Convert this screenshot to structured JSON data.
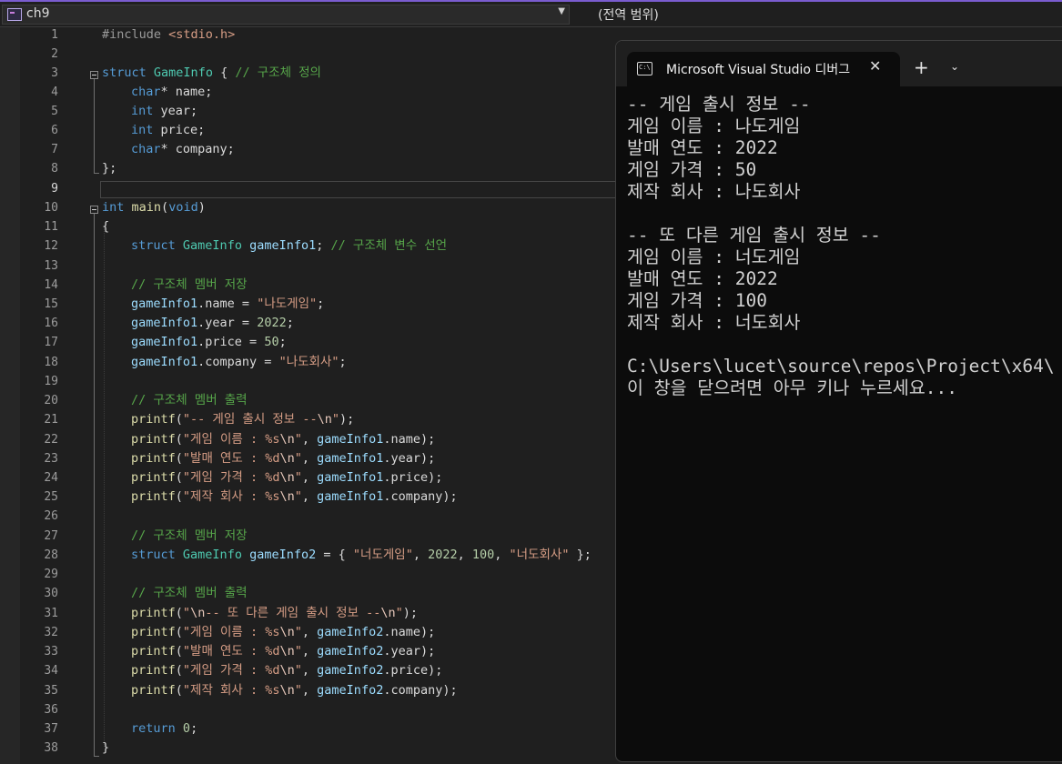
{
  "navbar": {
    "project": "ch9",
    "scope": "(전역 범위)"
  },
  "editor": {
    "line_numbers": [
      "1",
      "2",
      "3",
      "4",
      "5",
      "6",
      "7",
      "8",
      "9",
      "10",
      "11",
      "12",
      "13",
      "14",
      "15",
      "16",
      "17",
      "18",
      "19",
      "20",
      "21",
      "22",
      "23",
      "24",
      "25",
      "26",
      "27",
      "28",
      "29",
      "30",
      "31",
      "32",
      "33",
      "34",
      "35",
      "36",
      "37",
      "38"
    ],
    "tokens": {
      "l1": [
        "#include ",
        "<stdio.h>"
      ],
      "l3": [
        "struct",
        " ",
        "GameInfo",
        " { ",
        "// 구조체 정의"
      ],
      "l4": [
        "char",
        "* name;"
      ],
      "l5": [
        "int",
        " year;"
      ],
      "l6": [
        "int",
        " price;"
      ],
      "l7": [
        "char",
        "* company;"
      ],
      "l8": [
        "};"
      ],
      "l10": [
        "int",
        " ",
        "main",
        "(",
        "void",
        ")"
      ],
      "l11": [
        "{"
      ],
      "l12": [
        "struct",
        " ",
        "GameInfo",
        " ",
        "gameInfo1",
        "; ",
        "// 구조체 변수 선언"
      ],
      "l14": [
        "// 구조체 멤버 저장"
      ],
      "l15": [
        "gameInfo1",
        ".name = ",
        "\"나도게임\"",
        ";"
      ],
      "l16": [
        "gameInfo1",
        ".year = ",
        "2022",
        ";"
      ],
      "l17": [
        "gameInfo1",
        ".price = ",
        "50",
        ";"
      ],
      "l18": [
        "gameInfo1",
        ".company = ",
        "\"나도회사\"",
        ";"
      ],
      "l20": [
        "// 구조체 멤버 출력"
      ],
      "l21": [
        "printf",
        "(",
        "\"-- 게임 출시 정보 --",
        "\\n",
        "\"",
        ");"
      ],
      "l22": [
        "printf",
        "(",
        "\"게임 이름 : %s",
        "\\n",
        "\"",
        ", ",
        "gameInfo1",
        ".name);"
      ],
      "l23": [
        "printf",
        "(",
        "\"발매 연도 : %d",
        "\\n",
        "\"",
        ", ",
        "gameInfo1",
        ".year);"
      ],
      "l24": [
        "printf",
        "(",
        "\"게임 가격 : %d",
        "\\n",
        "\"",
        ", ",
        "gameInfo1",
        ".price);"
      ],
      "l25": [
        "printf",
        "(",
        "\"제작 회사 : %s",
        "\\n",
        "\"",
        ", ",
        "gameInfo1",
        ".company);"
      ],
      "l27": [
        "// 구조체 멤버 저장"
      ],
      "l28": [
        "struct",
        " ",
        "GameInfo",
        " ",
        "gameInfo2",
        " = { ",
        "\"너도게임\"",
        ", ",
        "2022",
        ", ",
        "100",
        ", ",
        "\"너도회사\"",
        " };"
      ],
      "l30": [
        "// 구조체 멤버 출력"
      ],
      "l31": [
        "printf",
        "(",
        "\"",
        "\\n",
        "-- 또 다른 게임 출시 정보 --",
        "\\n",
        "\"",
        ");"
      ],
      "l32": [
        "printf",
        "(",
        "\"게임 이름 : %s",
        "\\n",
        "\"",
        ", ",
        "gameInfo2",
        ".name);"
      ],
      "l33": [
        "printf",
        "(",
        "\"발매 연도 : %d",
        "\\n",
        "\"",
        ", ",
        "gameInfo2",
        ".year);"
      ],
      "l34": [
        "printf",
        "(",
        "\"게임 가격 : %d",
        "\\n",
        "\"",
        ", ",
        "gameInfo2",
        ".price);"
      ],
      "l35": [
        "printf",
        "(",
        "\"제작 회사 : %s",
        "\\n",
        "\"",
        ", ",
        "gameInfo2",
        ".company);"
      ],
      "l37": [
        "return",
        " ",
        "0",
        ";"
      ],
      "l38": [
        "}"
      ]
    }
  },
  "console": {
    "icon_text": "C:\\",
    "tab_title": "Microsoft Visual Studio 디버그",
    "close_label": "✕",
    "new_tab_label": "+",
    "dropdown_label": "⌄",
    "output": [
      "-- 게임 출시 정보 --",
      "게임 이름 : 나도게임",
      "발매 연도 : 2022",
      "게임 가격 : 50",
      "제작 회사 : 나도회사",
      "",
      "-- 또 다른 게임 출시 정보 --",
      "게임 이름 : 너도게임",
      "발매 연도 : 2022",
      "게임 가격 : 100",
      "제작 회사 : 너도회사",
      "",
      "C:\\Users\\lucet\\source\\repos\\Project\\x64\\",
      "이 창을 닫으려면 아무 키나 누르세요..."
    ]
  },
  "colors": {
    "keyword": "#569cd6",
    "type": "#4ec9b0",
    "string": "#d69d85",
    "comment": "#57a64a",
    "identifier": "#9cdcfe",
    "function": "#dcdcaa",
    "number": "#b5cea8"
  }
}
